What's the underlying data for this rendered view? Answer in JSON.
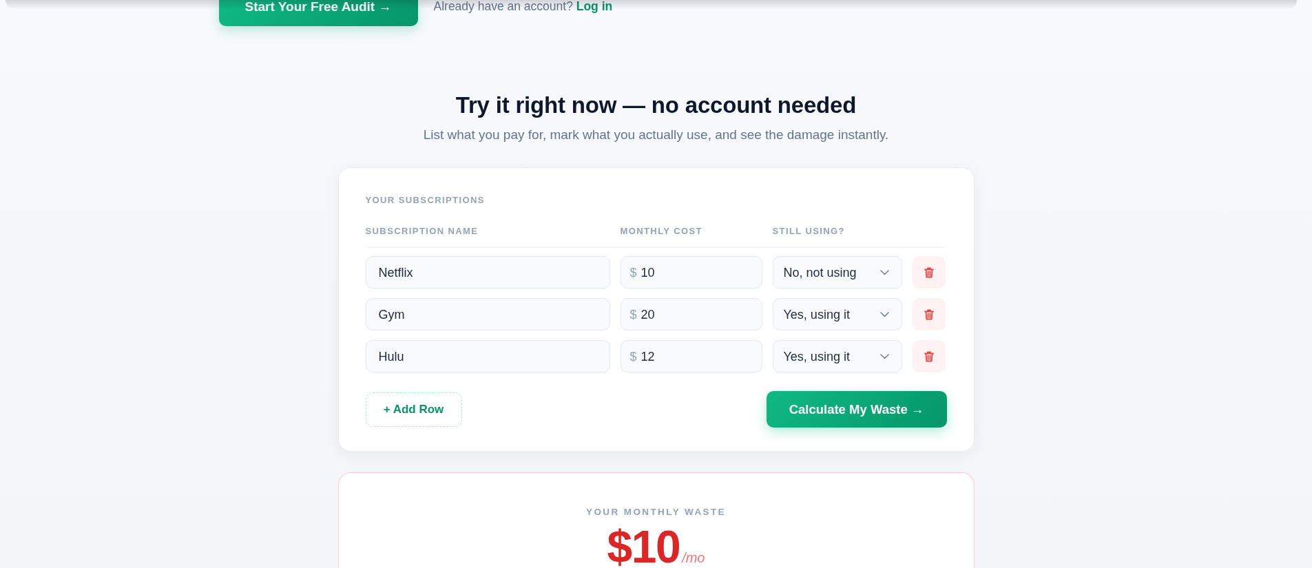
{
  "hero": {
    "cta_button": "Start Your Free Audit →",
    "login_prompt": "Already have an account?",
    "login_link": "Log in"
  },
  "demo": {
    "title": "Try it right now — no account needed",
    "subtitle": "List what you pay for, mark what you actually use, and see the damage instantly.",
    "card": {
      "section_label": "YOUR SUBSCRIPTIONS",
      "columns": [
        "SUBSCRIPTION NAME",
        "MONTHLY COST",
        "STILL USING?"
      ],
      "rows": [
        {
          "name": "Netflix",
          "currency": "$",
          "cost": "10",
          "status": "No, not using"
        },
        {
          "name": "Gym",
          "currency": "$",
          "cost": "20",
          "status": "Yes, using it"
        },
        {
          "name": "Hulu",
          "currency": "$",
          "cost": "12",
          "status": "Yes, using it"
        }
      ],
      "add_button": "+ Add Row",
      "calculate_button": "Calculate My Waste →"
    }
  },
  "result": {
    "label": "YOUR MONTHLY WASTE",
    "amount": "$10",
    "unit": "/mo"
  }
}
